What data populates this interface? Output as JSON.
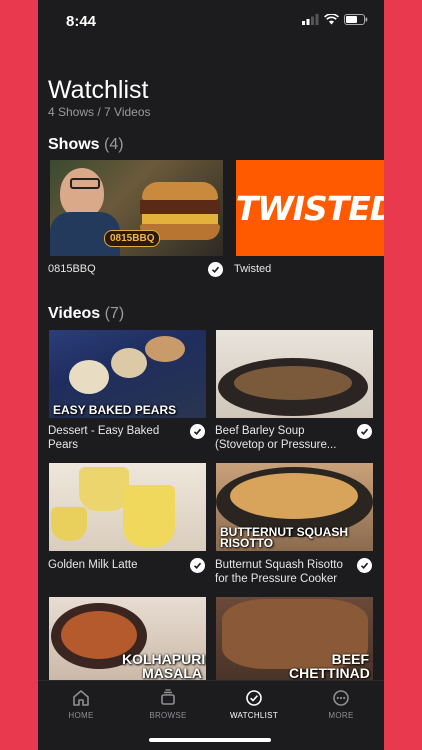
{
  "status": {
    "time": "8:44"
  },
  "header": {
    "title": "Watchlist",
    "subtitle": "4 Shows / 7 Videos"
  },
  "shows": {
    "heading": "Shows",
    "count": "(4)",
    "items": [
      {
        "label": "0815BBQ",
        "badge": "0815BBQ"
      },
      {
        "label": "Twisted",
        "logo": "TWISTED"
      }
    ]
  },
  "videos": {
    "heading": "Videos",
    "count": "(7)",
    "items": [
      {
        "title": "Dessert - Easy Baked Pears",
        "overlay": "EASY BAKED PEARS"
      },
      {
        "title": "Beef Barley Soup (Stovetop or Pressure...",
        "overlay": ""
      },
      {
        "title": "Golden Milk Latte",
        "overlay": ""
      },
      {
        "title": "Butternut Squash Risotto for the Pressure Cooker",
        "overlay": "BUTTERNUT SQUASH RISOTTO"
      },
      {
        "title": "",
        "overlay": "KOLHAPURI MASALA"
      },
      {
        "title": "",
        "overlay": "BEEF CHETTINAD"
      }
    ]
  },
  "tabs": [
    {
      "label": "HOME",
      "icon": "home-icon"
    },
    {
      "label": "BROWSE",
      "icon": "browse-icon"
    },
    {
      "label": "WATCHLIST",
      "icon": "watchlist-icon"
    },
    {
      "label": "MORE",
      "icon": "more-icon"
    }
  ],
  "colors": {
    "accent": "#ff5a00",
    "background": "#1c1c1e",
    "frame": "#e8394f"
  }
}
